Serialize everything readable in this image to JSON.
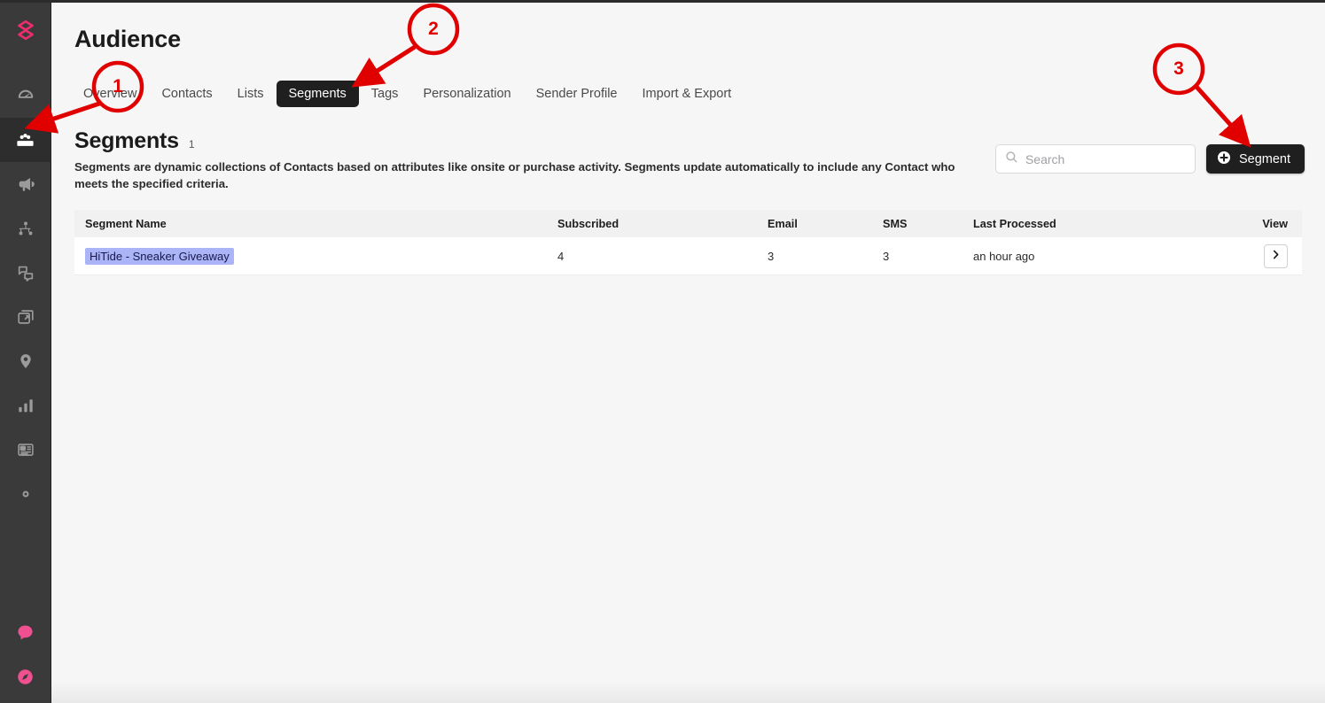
{
  "app": {
    "brand_color": "#ef2d6d",
    "sidebar_bg": "#3a3a3a",
    "accent_dark": "#1f1f1f"
  },
  "sidebar": {
    "logo_name": "app-logo",
    "items": [
      {
        "name": "dashboard-icon",
        "label": "Dashboard",
        "active": false
      },
      {
        "name": "audience-icon",
        "label": "Audience",
        "active": true
      },
      {
        "name": "megaphone-icon",
        "label": "Campaigns",
        "active": false
      },
      {
        "name": "flows-icon",
        "label": "Flows",
        "active": false
      },
      {
        "name": "messages-icon",
        "label": "Messages",
        "active": false
      },
      {
        "name": "media-icon",
        "label": "Media",
        "active": false
      },
      {
        "name": "location-pin-icon",
        "label": "Places",
        "active": false
      },
      {
        "name": "analytics-icon",
        "label": "Analytics",
        "active": false
      },
      {
        "name": "content-icon",
        "label": "Content",
        "active": false
      },
      {
        "name": "settings-gear-icon",
        "label": "Settings",
        "active": false
      }
    ],
    "bottom_items": [
      {
        "name": "chat-bubble-icon",
        "label": "Support Chat"
      },
      {
        "name": "compass-icon",
        "label": "Explore"
      }
    ]
  },
  "header": {
    "title": "Audience"
  },
  "tabs": [
    {
      "label": "Overview",
      "active": false
    },
    {
      "label": "Contacts",
      "active": false
    },
    {
      "label": "Lists",
      "active": false
    },
    {
      "label": "Segments",
      "active": true
    },
    {
      "label": "Tags",
      "active": false
    },
    {
      "label": "Personalization",
      "active": false
    },
    {
      "label": "Sender Profile",
      "active": false
    },
    {
      "label": "Import & Export",
      "active": false
    }
  ],
  "section": {
    "title": "Segments",
    "count": "1",
    "description": "Segments are dynamic collections of Contacts based on attributes like onsite or purchase activity. Segments update automatically to include any Contact who meets the specified criteria."
  },
  "search": {
    "placeholder": "Search",
    "value": ""
  },
  "actions": {
    "segment_button_label": "Segment"
  },
  "table": {
    "columns": [
      "Segment Name",
      "Subscribed",
      "Email",
      "SMS",
      "Last Processed",
      "View"
    ],
    "rows": [
      {
        "segment_name": "HiTide - Sneaker Giveaway",
        "subscribed": "4",
        "email": "3",
        "sms": "3",
        "last_processed": "an hour ago"
      }
    ]
  },
  "annotations": [
    {
      "number": "1",
      "target": "sidebar-audience-icon"
    },
    {
      "number": "2",
      "target": "segments-tab"
    },
    {
      "number": "3",
      "target": "segment-button"
    }
  ]
}
